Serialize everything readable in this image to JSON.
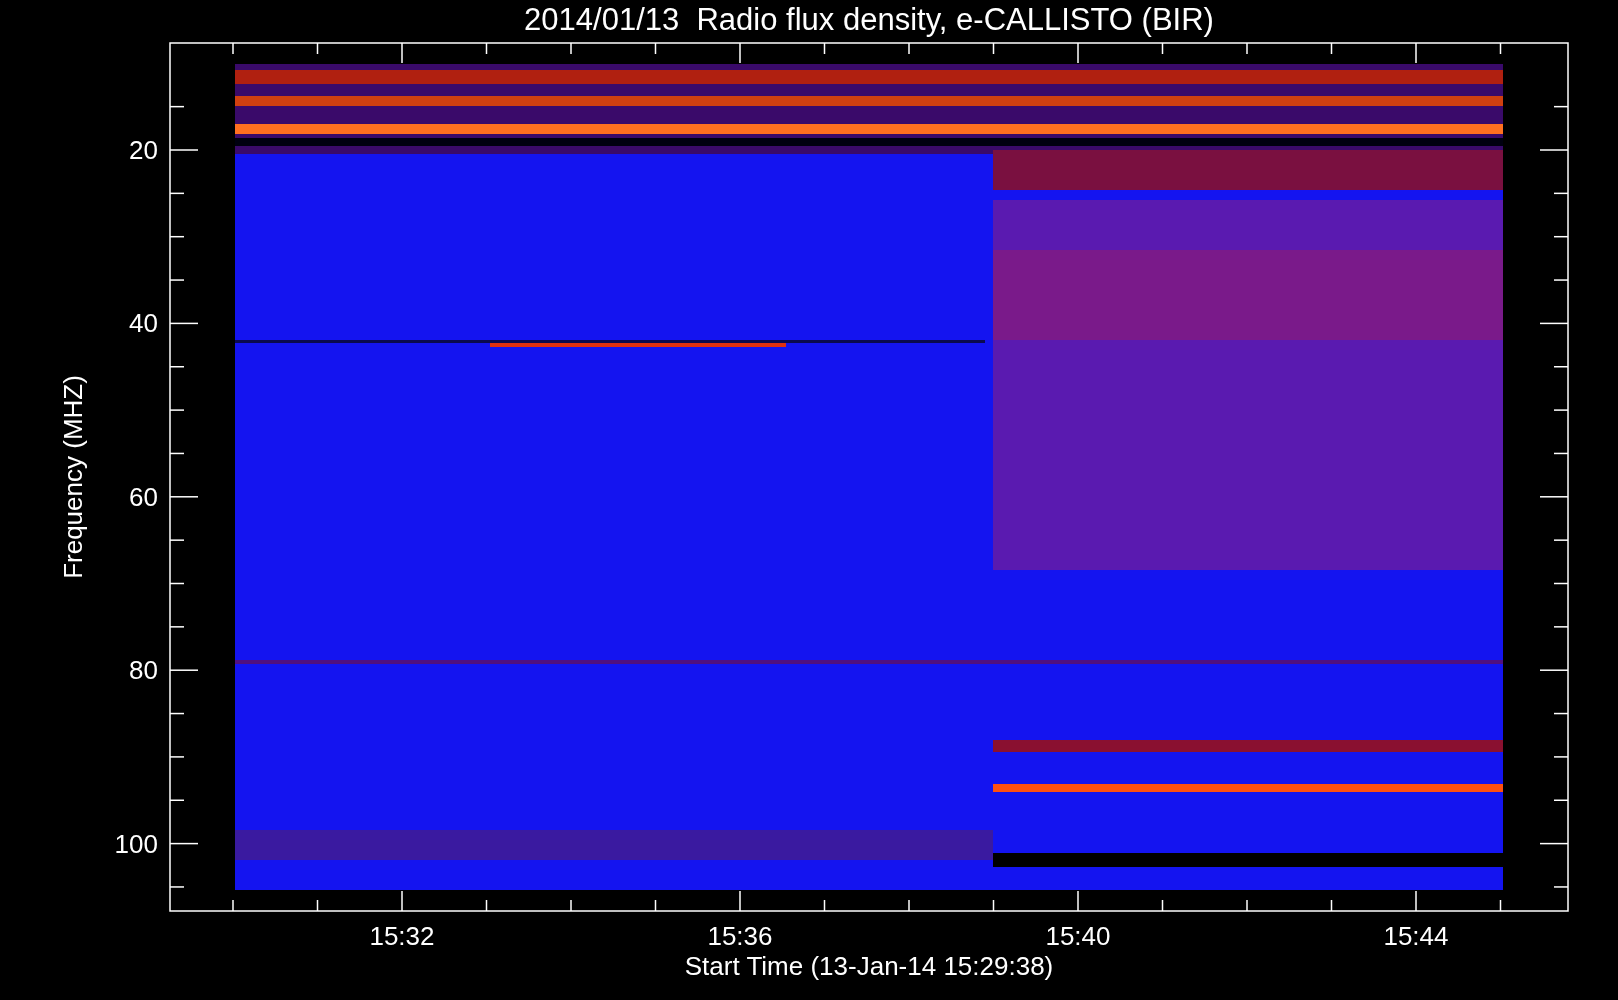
{
  "plot": {
    "title": "2014/01/13  Radio flux density, e-CALLISTO (BIR)",
    "xlabel": "Start Time (13-Jan-14 15:29:38)",
    "ylabel": "Frequency (MHZ)",
    "xticks": [
      "15:32",
      "15:36",
      "15:40",
      "15:44"
    ],
    "yticks": [
      "20",
      "40",
      "60",
      "80",
      "100"
    ]
  }
}
